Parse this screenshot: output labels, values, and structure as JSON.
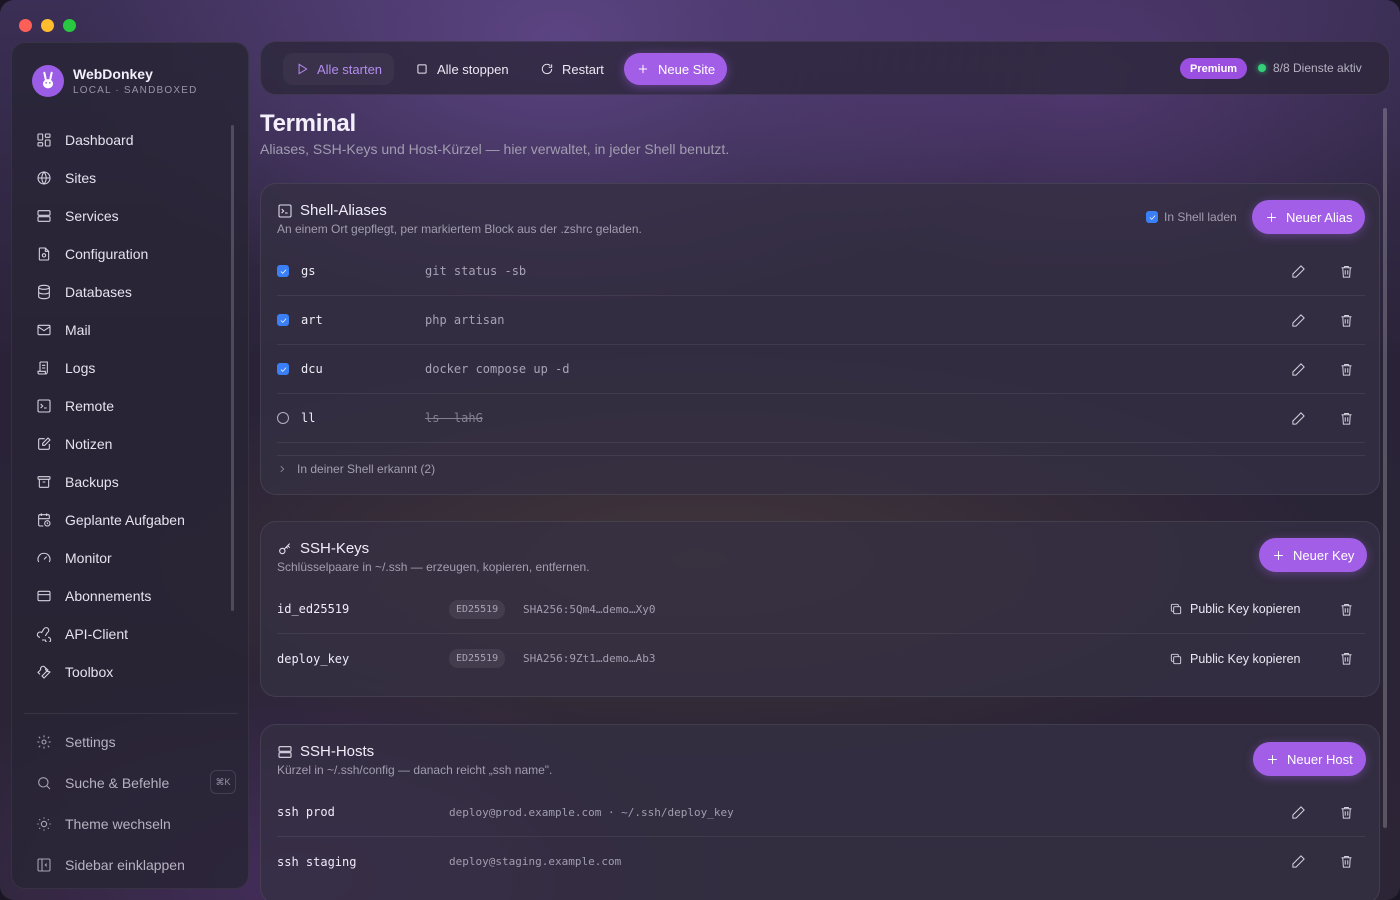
{
  "brand": {
    "name": "WebDonkey",
    "subtitle": "LOCAL · SANDBOXED"
  },
  "sidebar": {
    "items": [
      {
        "label": "Dashboard",
        "icon": "dashboard-icon"
      },
      {
        "label": "Sites",
        "icon": "globe-icon"
      },
      {
        "label": "Services",
        "icon": "server-icon"
      },
      {
        "label": "Configuration",
        "icon": "config-file-icon"
      },
      {
        "label": "Databases",
        "icon": "database-icon"
      },
      {
        "label": "Mail",
        "icon": "mail-icon"
      },
      {
        "label": "Logs",
        "icon": "logs-icon"
      },
      {
        "label": "Remote",
        "icon": "terminal-icon"
      },
      {
        "label": "Notizen",
        "icon": "notes-icon"
      },
      {
        "label": "Backups",
        "icon": "archive-icon"
      },
      {
        "label": "Geplante Aufgaben",
        "icon": "calendar-clock-icon"
      },
      {
        "label": "Monitor",
        "icon": "gauge-icon"
      },
      {
        "label": "Abonnements",
        "icon": "credit-card-icon"
      },
      {
        "label": "API-Client",
        "icon": "webhook-icon"
      },
      {
        "label": "Toolbox",
        "icon": "wrench-icon"
      }
    ],
    "bottom": [
      {
        "label": "Settings",
        "icon": "gear-icon"
      },
      {
        "label": "Suche & Befehle",
        "icon": "search-icon",
        "shortcut": "⌘K"
      },
      {
        "label": "Theme wechseln",
        "icon": "sun-icon"
      },
      {
        "label": "Sidebar einklappen",
        "icon": "sidebar-collapse-icon"
      }
    ]
  },
  "toolbar": {
    "start_all": "Alle starten",
    "stop_all": "Alle stoppen",
    "restart": "Restart",
    "new_site": "Neue Site",
    "premium_badge": "Premium",
    "status_text": "8/8 Dienste aktiv",
    "status_color": "#34d07a"
  },
  "page": {
    "title": "Terminal",
    "subtitle": "Aliases, SSH-Keys und Host-Kürzel — hier verwaltet, in jeder Shell benutzt."
  },
  "aliases": {
    "title": "Shell-Aliases",
    "description": "An einem Ort gepflegt, per markiertem Block aus der .zshrc geladen.",
    "load_in_shell_label": "In Shell laden",
    "load_in_shell_checked": true,
    "new_button": "Neuer Alias",
    "rows": [
      {
        "name": "gs",
        "command": "git status -sb",
        "enabled": true
      },
      {
        "name": "art",
        "command": "php artisan",
        "enabled": true
      },
      {
        "name": "dcu",
        "command": "docker compose up -d",
        "enabled": true
      },
      {
        "name": "ll",
        "command": "ls -lahG",
        "enabled": false
      }
    ],
    "detected_label": "In deiner Shell erkannt (2)"
  },
  "ssh_keys": {
    "title": "SSH-Keys",
    "description": "Schlüsselpaare in ~/.ssh — erzeugen, kopieren, entfernen.",
    "new_button": "Neuer Key",
    "copy_label": "Public Key kopieren",
    "rows": [
      {
        "name": "id_ed25519",
        "type": "ED25519",
        "fingerprint": "SHA256:5Qm4…demo…Xy0"
      },
      {
        "name": "deploy_key",
        "type": "ED25519",
        "fingerprint": "SHA256:9Zt1…demo…Ab3"
      }
    ]
  },
  "ssh_hosts": {
    "title": "SSH-Hosts",
    "description": "Kürzel in ~/.ssh/config — danach reicht „ssh name\".",
    "new_button": "Neuer Host",
    "rows": [
      {
        "name": "ssh prod",
        "target": "deploy@prod.example.com · ~/.ssh/deploy_key"
      },
      {
        "name": "ssh staging",
        "target": "deploy@staging.example.com"
      }
    ]
  },
  "colors": {
    "accent": "#a35ee8",
    "checkbox": "#3a7ff6"
  }
}
